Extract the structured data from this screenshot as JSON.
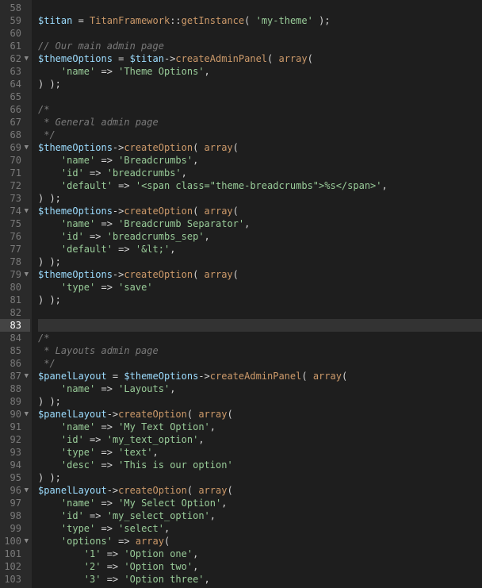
{
  "gutter": [
    {
      "n": "58",
      "fold": false
    },
    {
      "n": "59",
      "fold": false
    },
    {
      "n": "60",
      "fold": false
    },
    {
      "n": "61",
      "fold": false
    },
    {
      "n": "62",
      "fold": true
    },
    {
      "n": "63",
      "fold": false
    },
    {
      "n": "64",
      "fold": false
    },
    {
      "n": "65",
      "fold": false
    },
    {
      "n": "66",
      "fold": false
    },
    {
      "n": "67",
      "fold": false
    },
    {
      "n": "68",
      "fold": false
    },
    {
      "n": "69",
      "fold": true
    },
    {
      "n": "70",
      "fold": false
    },
    {
      "n": "71",
      "fold": false
    },
    {
      "n": "72",
      "fold": false
    },
    {
      "n": "73",
      "fold": false
    },
    {
      "n": "74",
      "fold": true
    },
    {
      "n": "75",
      "fold": false
    },
    {
      "n": "76",
      "fold": false
    },
    {
      "n": "77",
      "fold": false
    },
    {
      "n": "78",
      "fold": false
    },
    {
      "n": "79",
      "fold": true
    },
    {
      "n": "80",
      "fold": false
    },
    {
      "n": "81",
      "fold": false
    },
    {
      "n": "82",
      "fold": false
    },
    {
      "n": "83",
      "fold": false,
      "active": true
    },
    {
      "n": "84",
      "fold": false
    },
    {
      "n": "85",
      "fold": false
    },
    {
      "n": "86",
      "fold": false
    },
    {
      "n": "87",
      "fold": true
    },
    {
      "n": "88",
      "fold": false
    },
    {
      "n": "89",
      "fold": false
    },
    {
      "n": "90",
      "fold": true
    },
    {
      "n": "91",
      "fold": false
    },
    {
      "n": "92",
      "fold": false
    },
    {
      "n": "93",
      "fold": false
    },
    {
      "n": "94",
      "fold": false
    },
    {
      "n": "95",
      "fold": false
    },
    {
      "n": "96",
      "fold": true
    },
    {
      "n": "97",
      "fold": false
    },
    {
      "n": "98",
      "fold": false
    },
    {
      "n": "99",
      "fold": false
    },
    {
      "n": "100",
      "fold": true
    },
    {
      "n": "101",
      "fold": false
    },
    {
      "n": "102",
      "fold": false
    },
    {
      "n": "103",
      "fold": false
    }
  ],
  "foldGlyph": "▼",
  "lines": [
    [],
    [
      [
        "var",
        "$titan"
      ],
      [
        "op",
        " = "
      ],
      [
        "cls",
        "TitanFramework"
      ],
      [
        "punc",
        "::"
      ],
      [
        "func",
        "getInstance"
      ],
      [
        "punc",
        "( "
      ],
      [
        "str",
        "'my-theme'"
      ],
      [
        "punc",
        " );"
      ]
    ],
    [],
    [
      [
        "cmt",
        "// Our main admin page"
      ]
    ],
    [
      [
        "var",
        "$themeOptions"
      ],
      [
        "op",
        " = "
      ],
      [
        "var",
        "$titan"
      ],
      [
        "arrow",
        "->"
      ],
      [
        "func",
        "createAdminPanel"
      ],
      [
        "punc",
        "( "
      ],
      [
        "prim",
        "array"
      ],
      [
        "punc",
        "("
      ]
    ],
    [
      [
        "punc",
        "    "
      ],
      [
        "str",
        "'name'"
      ],
      [
        "op",
        " => "
      ],
      [
        "str",
        "'Theme Options'"
      ],
      [
        "punc",
        ","
      ]
    ],
    [
      [
        "punc",
        ") );"
      ]
    ],
    [],
    [
      [
        "cmt",
        "/*"
      ]
    ],
    [
      [
        "cmt",
        " * General admin page"
      ]
    ],
    [
      [
        "cmt",
        " */"
      ]
    ],
    [
      [
        "var",
        "$themeOptions"
      ],
      [
        "arrow",
        "->"
      ],
      [
        "func",
        "createOption"
      ],
      [
        "punc",
        "( "
      ],
      [
        "prim",
        "array"
      ],
      [
        "punc",
        "("
      ]
    ],
    [
      [
        "punc",
        "    "
      ],
      [
        "str",
        "'name'"
      ],
      [
        "op",
        " => "
      ],
      [
        "str",
        "'Breadcrumbs'"
      ],
      [
        "punc",
        ","
      ]
    ],
    [
      [
        "punc",
        "    "
      ],
      [
        "str",
        "'id'"
      ],
      [
        "op",
        " => "
      ],
      [
        "str",
        "'breadcrumbs'"
      ],
      [
        "punc",
        ","
      ]
    ],
    [
      [
        "punc",
        "    "
      ],
      [
        "str",
        "'default'"
      ],
      [
        "op",
        " => "
      ],
      [
        "str",
        "'<span class=\"theme-breadcrumbs\">%s</span>'"
      ],
      [
        "punc",
        ","
      ]
    ],
    [
      [
        "punc",
        ") );"
      ]
    ],
    [
      [
        "var",
        "$themeOptions"
      ],
      [
        "arrow",
        "->"
      ],
      [
        "func",
        "createOption"
      ],
      [
        "punc",
        "( "
      ],
      [
        "prim",
        "array"
      ],
      [
        "punc",
        "("
      ]
    ],
    [
      [
        "punc",
        "    "
      ],
      [
        "str",
        "'name'"
      ],
      [
        "op",
        " => "
      ],
      [
        "str",
        "'Breadcrumb Separator'"
      ],
      [
        "punc",
        ","
      ]
    ],
    [
      [
        "punc",
        "    "
      ],
      [
        "str",
        "'id'"
      ],
      [
        "op",
        " => "
      ],
      [
        "str",
        "'breadcrumbs_sep'"
      ],
      [
        "punc",
        ","
      ]
    ],
    [
      [
        "punc",
        "    "
      ],
      [
        "str",
        "'default'"
      ],
      [
        "op",
        " => "
      ],
      [
        "str",
        "'&lt;'"
      ],
      [
        "punc",
        ","
      ]
    ],
    [
      [
        "punc",
        ") );"
      ]
    ],
    [
      [
        "var",
        "$themeOptions"
      ],
      [
        "arrow",
        "->"
      ],
      [
        "func",
        "createOption"
      ],
      [
        "punc",
        "( "
      ],
      [
        "prim",
        "array"
      ],
      [
        "punc",
        "("
      ]
    ],
    [
      [
        "punc",
        "    "
      ],
      [
        "str",
        "'type'"
      ],
      [
        "op",
        " => "
      ],
      [
        "str",
        "'save'"
      ]
    ],
    [
      [
        "punc",
        ") );"
      ]
    ],
    [],
    [],
    [
      [
        "cmt",
        "/*"
      ]
    ],
    [
      [
        "cmt",
        " * Layouts admin page"
      ]
    ],
    [
      [
        "cmt",
        " */"
      ]
    ],
    [
      [
        "var",
        "$panelLayout"
      ],
      [
        "op",
        " = "
      ],
      [
        "var",
        "$themeOptions"
      ],
      [
        "arrow",
        "->"
      ],
      [
        "func",
        "createAdminPanel"
      ],
      [
        "punc",
        "( "
      ],
      [
        "prim",
        "array"
      ],
      [
        "punc",
        "("
      ]
    ],
    [
      [
        "punc",
        "    "
      ],
      [
        "str",
        "'name'"
      ],
      [
        "op",
        " => "
      ],
      [
        "str",
        "'Layouts'"
      ],
      [
        "punc",
        ","
      ]
    ],
    [
      [
        "punc",
        ") );"
      ]
    ],
    [
      [
        "var",
        "$panelLayout"
      ],
      [
        "arrow",
        "->"
      ],
      [
        "func",
        "createOption"
      ],
      [
        "punc",
        "( "
      ],
      [
        "prim",
        "array"
      ],
      [
        "punc",
        "("
      ]
    ],
    [
      [
        "punc",
        "    "
      ],
      [
        "str",
        "'name'"
      ],
      [
        "op",
        " => "
      ],
      [
        "str",
        "'My Text Option'"
      ],
      [
        "punc",
        ","
      ]
    ],
    [
      [
        "punc",
        "    "
      ],
      [
        "str",
        "'id'"
      ],
      [
        "op",
        " => "
      ],
      [
        "str",
        "'my_text_option'"
      ],
      [
        "punc",
        ","
      ]
    ],
    [
      [
        "punc",
        "    "
      ],
      [
        "str",
        "'type'"
      ],
      [
        "op",
        " => "
      ],
      [
        "str",
        "'text'"
      ],
      [
        "punc",
        ","
      ]
    ],
    [
      [
        "punc",
        "    "
      ],
      [
        "str",
        "'desc'"
      ],
      [
        "op",
        " => "
      ],
      [
        "str",
        "'This is our option'"
      ]
    ],
    [
      [
        "punc",
        ") );"
      ]
    ],
    [
      [
        "var",
        "$panelLayout"
      ],
      [
        "arrow",
        "->"
      ],
      [
        "func",
        "createOption"
      ],
      [
        "punc",
        "( "
      ],
      [
        "prim",
        "array"
      ],
      [
        "punc",
        "("
      ]
    ],
    [
      [
        "punc",
        "    "
      ],
      [
        "str",
        "'name'"
      ],
      [
        "op",
        " => "
      ],
      [
        "str",
        "'My Select Option'"
      ],
      [
        "punc",
        ","
      ]
    ],
    [
      [
        "punc",
        "    "
      ],
      [
        "str",
        "'id'"
      ],
      [
        "op",
        " => "
      ],
      [
        "str",
        "'my_select_option'"
      ],
      [
        "punc",
        ","
      ]
    ],
    [
      [
        "punc",
        "    "
      ],
      [
        "str",
        "'type'"
      ],
      [
        "op",
        " => "
      ],
      [
        "str",
        "'select'"
      ],
      [
        "punc",
        ","
      ]
    ],
    [
      [
        "punc",
        "    "
      ],
      [
        "str",
        "'options'"
      ],
      [
        "op",
        " => "
      ],
      [
        "prim",
        "array"
      ],
      [
        "punc",
        "("
      ]
    ],
    [
      [
        "punc",
        "        "
      ],
      [
        "str",
        "'1'"
      ],
      [
        "op",
        " => "
      ],
      [
        "str",
        "'Option one'"
      ],
      [
        "punc",
        ","
      ]
    ],
    [
      [
        "punc",
        "        "
      ],
      [
        "str",
        "'2'"
      ],
      [
        "op",
        " => "
      ],
      [
        "str",
        "'Option two'"
      ],
      [
        "punc",
        ","
      ]
    ],
    [
      [
        "punc",
        "        "
      ],
      [
        "str",
        "'3'"
      ],
      [
        "op",
        " => "
      ],
      [
        "str",
        "'Option three'"
      ],
      [
        "punc",
        ","
      ]
    ]
  ]
}
